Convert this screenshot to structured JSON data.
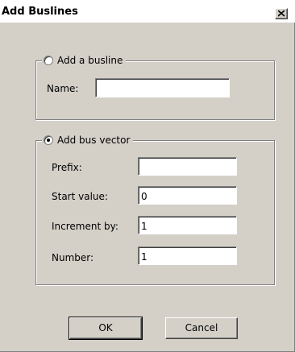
{
  "window": {
    "title": "Add Buslines",
    "close_glyph": "close-icon"
  },
  "busline_group": {
    "option_label": "Add a busline",
    "selected": false,
    "name_label": "Name:",
    "name_value": ""
  },
  "bus_vector_group": {
    "option_label": "Add bus vector",
    "selected": true,
    "prefix_label": "Prefix:",
    "prefix_value": "",
    "start_label": "Start value:",
    "start_value": "0",
    "increment_label": "Increment by:",
    "increment_value": "1",
    "number_label": "Number:",
    "number_value": "1"
  },
  "buttons": {
    "ok_label": "OK",
    "cancel_label": "Cancel"
  },
  "colors": {
    "dialog_background": "#d4d0c8",
    "titlebar_background": "#ffffff"
  }
}
